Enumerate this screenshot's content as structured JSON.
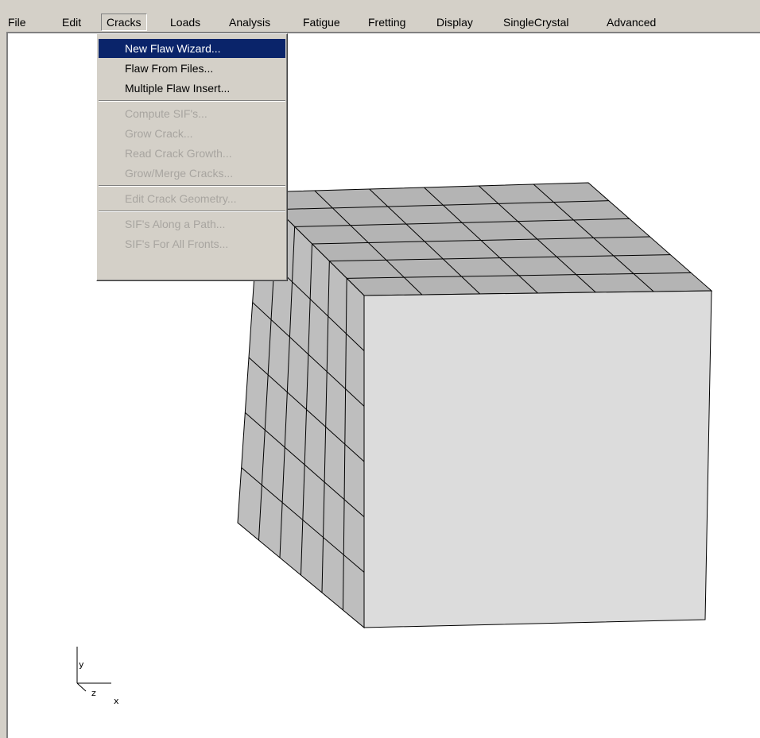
{
  "menubar": {
    "items": [
      "File",
      "Edit",
      "Cracks",
      "Loads",
      "Analysis",
      "Fatigue",
      "Fretting",
      "Display",
      "SingleCrystal",
      "Advanced"
    ],
    "open_menu": "Cracks"
  },
  "cracks_menu": {
    "items": [
      {
        "label": "New Flaw Wizard...",
        "state": "selected"
      },
      {
        "label": "Flaw From Files...",
        "state": "enabled"
      },
      {
        "label": "Multiple Flaw Insert...",
        "state": "enabled"
      },
      {
        "label": "Compute SIF's...",
        "state": "disabled"
      },
      {
        "label": "Grow Crack...",
        "state": "disabled"
      },
      {
        "label": "Read Crack Growth...",
        "state": "disabled"
      },
      {
        "label": "Grow/Merge Cracks...",
        "state": "disabled"
      },
      {
        "label": "Edit Crack Geometry...",
        "state": "disabled"
      },
      {
        "label": "SIF's Along a Path...",
        "state": "disabled"
      },
      {
        "label": "SIF's For All Fronts...",
        "state": "disabled"
      }
    ]
  },
  "model": {
    "mesh_divisions": 6,
    "face_colors": {
      "front": "#dcdcdc",
      "top": "#b4b4b4",
      "left": "#bebebe"
    },
    "edge_color": "#000000"
  },
  "axis_triad": {
    "x": "x",
    "y": "y",
    "z": "z"
  },
  "colors": {
    "selection": "#0a246a",
    "chrome": "#d4d0c8",
    "disabled_text": "#a8a5a0"
  }
}
